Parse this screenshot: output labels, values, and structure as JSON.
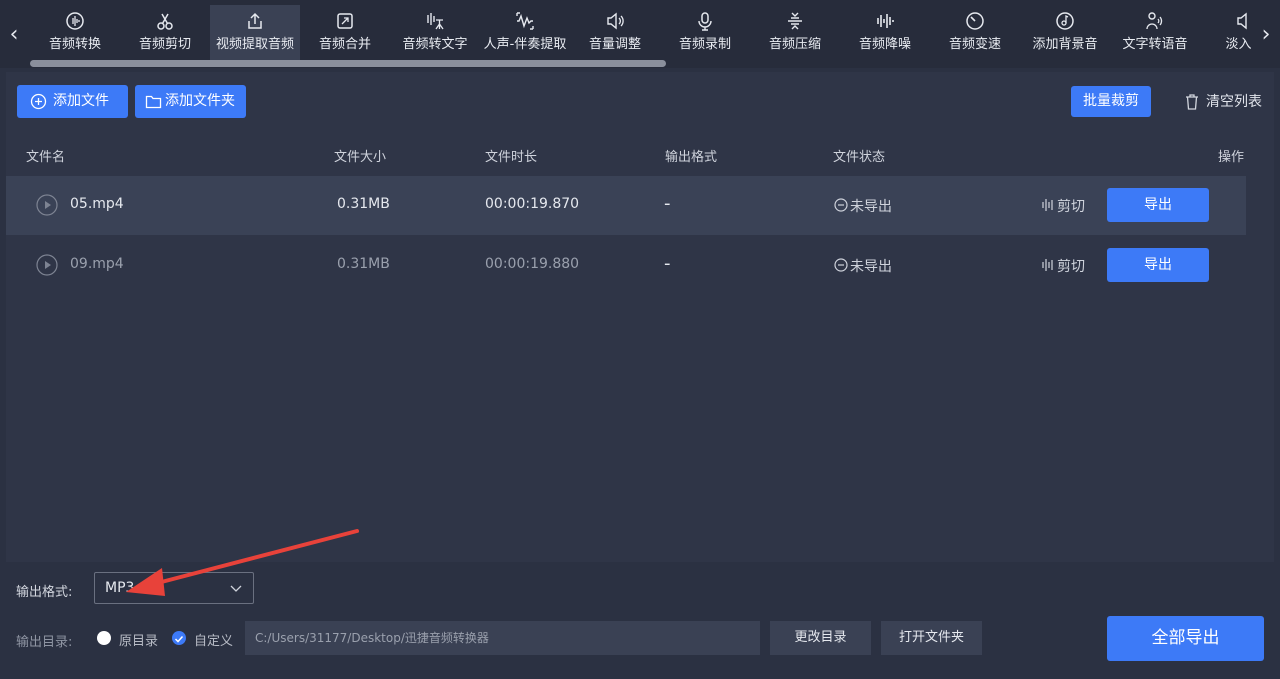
{
  "toolbar": {
    "tools": [
      {
        "label": "音频转换",
        "icon": "audio-wave-icon"
      },
      {
        "label": "音频剪切",
        "icon": "scissors-icon"
      },
      {
        "label": "视频提取音频",
        "icon": "upload-icon"
      },
      {
        "label": "音频合并",
        "icon": "merge-icon"
      },
      {
        "label": "音频转文字",
        "icon": "speech-text-icon"
      },
      {
        "label": "人声-伴奏提取",
        "icon": "voice-separate-icon"
      },
      {
        "label": "音量调整",
        "icon": "volume-icon"
      },
      {
        "label": "音频录制",
        "icon": "microphone-icon"
      },
      {
        "label": "音频压缩",
        "icon": "compress-icon"
      },
      {
        "label": "音频降噪",
        "icon": "noise-bars-icon"
      },
      {
        "label": "音频变速",
        "icon": "speed-icon"
      },
      {
        "label": "添加背景音",
        "icon": "music-disc-icon"
      },
      {
        "label": "文字转语音",
        "icon": "text-speech-icon"
      },
      {
        "label": "淡入淡",
        "icon": "fade-icon"
      }
    ],
    "active_index": 2,
    "accent": "#3d7af7"
  },
  "actions": {
    "add_file": "添加文件",
    "add_folder": "添加文件夹",
    "batch_cut": "批量裁剪",
    "clear_list": "清空列表"
  },
  "table": {
    "headers": {
      "name": "文件名",
      "size": "文件大小",
      "duration": "文件时长",
      "format": "输出格式",
      "status": "文件状态",
      "action": "操作"
    },
    "rows": [
      {
        "name": "05.mp4",
        "size": "0.31MB",
        "duration": "00:00:19.870",
        "format": "-",
        "status": "未导出",
        "cut": "剪切",
        "export": "导出"
      },
      {
        "name": "09.mp4",
        "size": "0.31MB",
        "duration": "00:00:19.880",
        "format": "-",
        "status": "未导出",
        "cut": "剪切",
        "export": "导出"
      }
    ]
  },
  "bottom": {
    "format_label": "输出格式:",
    "format_value": "MP3",
    "dir_label": "输出目录:",
    "radio_original": "原目录",
    "radio_custom": "自定义",
    "path": "C:/Users/31177/Desktop/迅捷音频转换器",
    "change_dir": "更改目录",
    "open_folder": "打开文件夹",
    "export_all": "全部导出"
  }
}
